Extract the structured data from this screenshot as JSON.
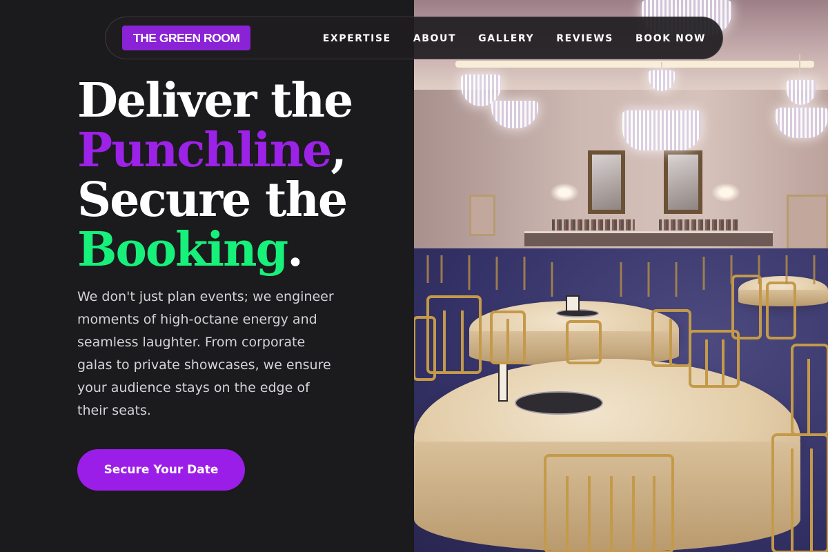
{
  "brand": {
    "logo_text": "THE GREEN ROOM",
    "accent_purple": "#9b22e6",
    "accent_green": "#17f07a"
  },
  "nav": {
    "links": [
      {
        "label": "EXPERTISE"
      },
      {
        "label": "ABOUT"
      },
      {
        "label": "GALLERY"
      },
      {
        "label": "REVIEWS"
      },
      {
        "label": "BOOK NOW"
      }
    ]
  },
  "hero": {
    "line1": "Deliver the",
    "line2_highlight": "Punchline",
    "line2_tail": ",",
    "line3": "Secure the",
    "line4_highlight": "Booking",
    "line4_tail": ".",
    "description": "We don't just plan events; we engineer moments of high-octane energy and seamless laughter. From corporate galas to private showcases, we ensure your audience stays on the edge of their seats.",
    "cta_label": "Secure Your Date"
  },
  "photo": {
    "subject": "ballroom-banquet-photo"
  }
}
